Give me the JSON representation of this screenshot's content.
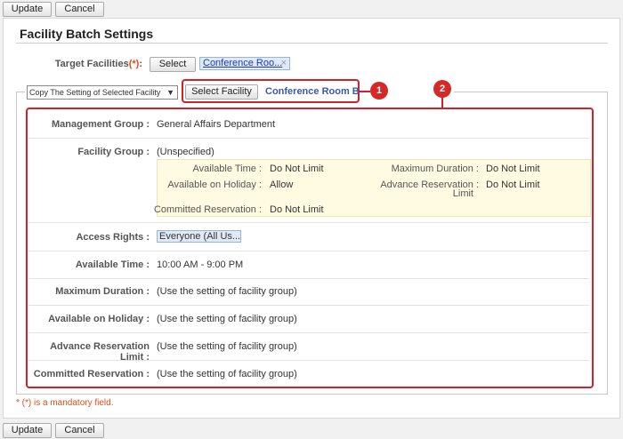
{
  "toolbar": {
    "update_label": "Update",
    "cancel_label": "Cancel"
  },
  "page_title": "Facility Batch Settings",
  "target": {
    "label": "Target Facilities",
    "required_mark": "(*)",
    "colon": ":",
    "select_label": "Select",
    "selected_facility": "Conference Roo...",
    "remove_icon": "×"
  },
  "copy": {
    "select_value": "Copy The Setting of Selected Facility",
    "select_facility_label": "Select Facility",
    "selected_facility": "Conference Room B"
  },
  "callouts": {
    "one": "1",
    "two": "2"
  },
  "settings": {
    "management_group": {
      "label": "Management Group :",
      "value": "General Affairs Department"
    },
    "facility_group": {
      "label": "Facility Group :",
      "value": "(Unspecified)",
      "details": {
        "available_time": {
          "label": "Available Time :",
          "value": "Do Not Limit"
        },
        "maximum_duration": {
          "label": "Maximum Duration :",
          "value": "Do Not Limit"
        },
        "available_on_holiday": {
          "label": "Available on Holiday :",
          "value": "Allow"
        },
        "advance_reservation": {
          "label_line1": "Advance Reservation :",
          "label_line2": "Limit",
          "value": "Do Not Limit"
        },
        "committed_reservation": {
          "label": "Committed Reservation :",
          "value": "Do Not Limit"
        }
      }
    },
    "access_rights": {
      "label": "Access Rights :",
      "value": "Everyone (All Us..."
    },
    "available_time": {
      "label": "Available Time :",
      "value": "10:00 AM - 9:00 PM"
    },
    "maximum_duration": {
      "label": "Maximum Duration :",
      "value": "(Use the setting of facility group)"
    },
    "available_on_holiday": {
      "label": "Available on Holiday :",
      "value": "(Use the setting of facility group)"
    },
    "advance_reservation_limit": {
      "label": "Advance Reservation Limit :",
      "value": "(Use the setting of facility group)"
    },
    "committed_reservation": {
      "label": "Committed Reservation :",
      "value": "(Use the setting of facility group)"
    }
  },
  "mandatory_note": "*  (*)  is a mandatory field.",
  "colors": {
    "callout_red": "#d0212d",
    "required_orange": "#e34a1a",
    "link_blue": "#1a3dad"
  }
}
